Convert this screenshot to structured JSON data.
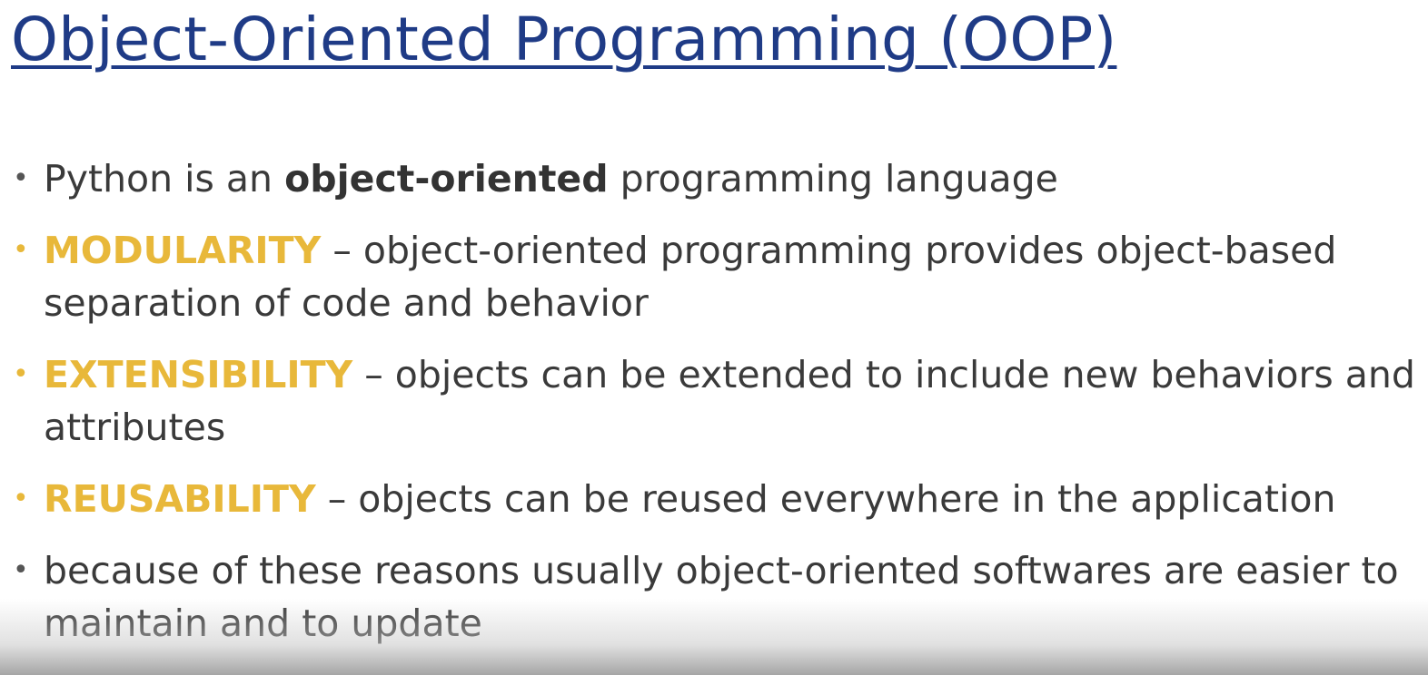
{
  "slide": {
    "title": "Object-Oriented Programming (OOP)",
    "bullets": [
      {
        "pre": "Python is an ",
        "bold": "object-oriented",
        "post": " programming language"
      },
      {
        "keyword": "MODULARITY",
        "text": " – object-oriented programming provides object-based separation of code and behavior"
      },
      {
        "keyword": "EXTENSIBILITY",
        "text": " – objects can be extended to include new behaviors and attributes"
      },
      {
        "keyword": "REUSABILITY",
        "text": " – objects can be reused everywhere in the application"
      },
      {
        "text": "because of these reasons usually object-oriented softwares are easier to maintain and to update"
      }
    ]
  },
  "colors": {
    "title": "#1f3b86",
    "keyword": "#e8b83a",
    "body_text": "#3a3a3a"
  }
}
